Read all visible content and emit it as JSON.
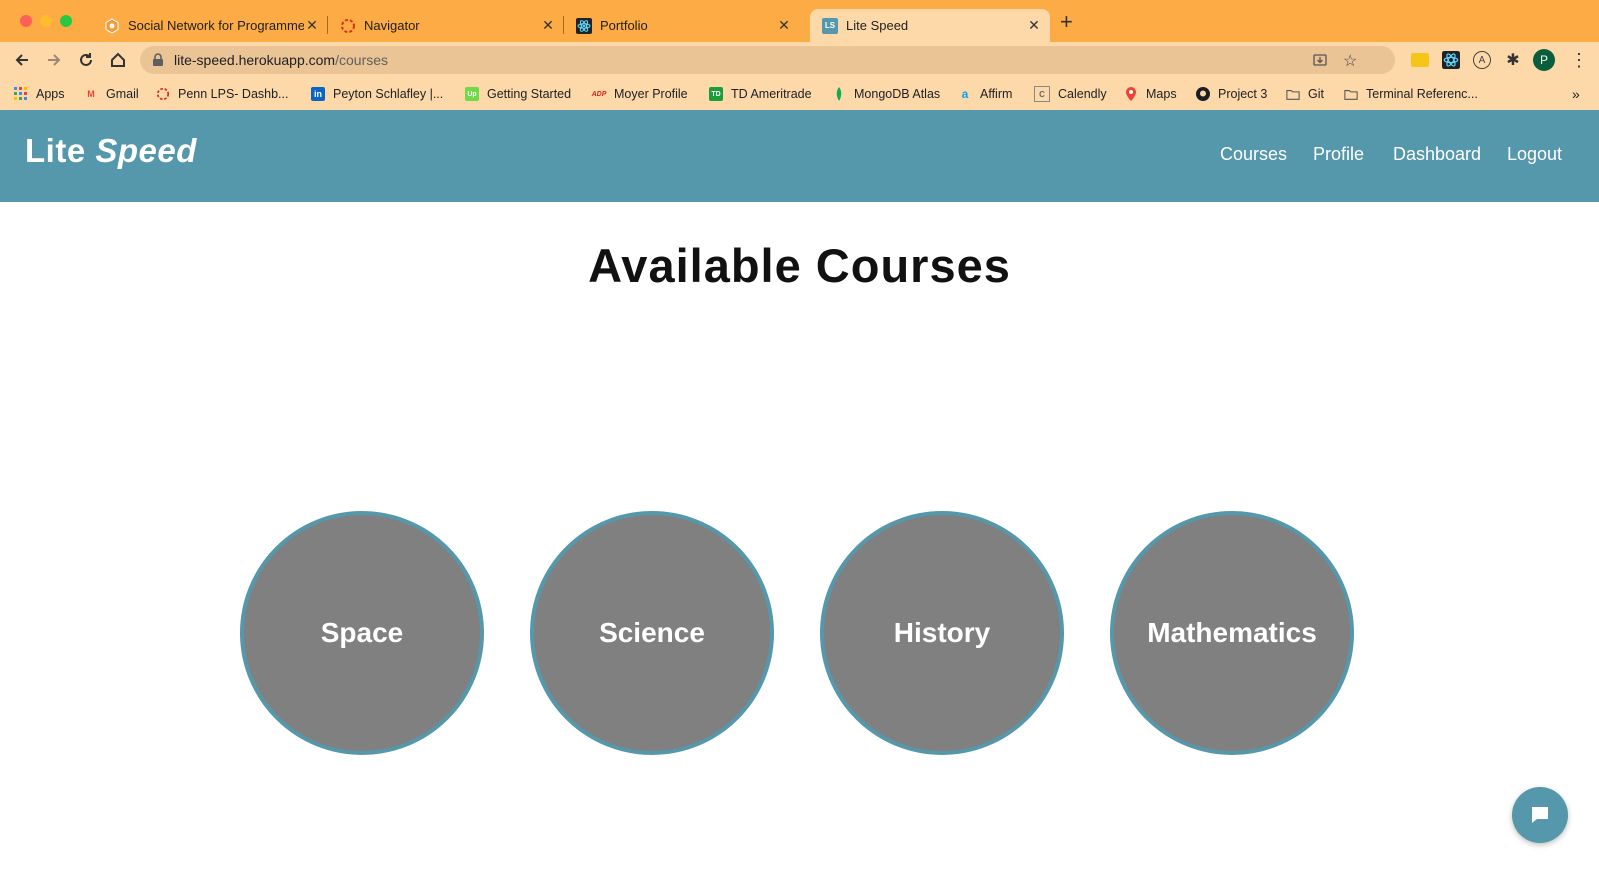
{
  "browser": {
    "tabs": [
      {
        "title": "Social Network for Programmers",
        "icon": "hexagon-icon"
      },
      {
        "title": "Navigator",
        "icon": "dashed-circle-icon"
      },
      {
        "title": "Portfolio",
        "icon": "react-icon"
      },
      {
        "title": "Lite Speed",
        "icon": "ls-icon",
        "favicon_text": "LS",
        "active": true
      }
    ],
    "url_host": "lite-speed.herokuapp.com",
    "url_path": "/courses",
    "profile_initial": "P",
    "bookmarks": [
      {
        "label": "Apps",
        "icon": "apps-grid-icon"
      },
      {
        "label": "Gmail",
        "icon": "gmail-icon",
        "icon_text": "M"
      },
      {
        "label": "Penn LPS- Dashb...",
        "icon": "dashed-circle-icon"
      },
      {
        "label": "Peyton Schlafley |...",
        "icon": "linkedin-icon",
        "icon_text": "in"
      },
      {
        "label": "Getting Started",
        "icon": "upwork-icon",
        "icon_text": "Up"
      },
      {
        "label": "Moyer Profile",
        "icon": "adp-icon",
        "icon_text": "ADP"
      },
      {
        "label": "TD Ameritrade",
        "icon": "td-icon",
        "icon_text": "TD"
      },
      {
        "label": "MongoDB Atlas",
        "icon": "mongodb-leaf-icon"
      },
      {
        "label": "Affirm",
        "icon": "affirm-icon",
        "icon_text": "a"
      },
      {
        "label": "Calendly",
        "icon": "calendly-icon",
        "icon_text": "C"
      },
      {
        "label": "Maps",
        "icon": "maps-pin-icon"
      },
      {
        "label": "Project 3",
        "icon": "github-icon"
      },
      {
        "label": "Git",
        "icon": "folder-icon"
      },
      {
        "label": "Terminal Referenc...",
        "icon": "folder-icon"
      }
    ]
  },
  "site": {
    "brand_main": "Lite",
    "brand_italic": "Speed",
    "nav": [
      "Courses",
      "Profile",
      "Dashboard",
      "Logout"
    ]
  },
  "page": {
    "title": "Available Courses",
    "courses": [
      "Space",
      "Science",
      "History",
      "Mathematics"
    ]
  },
  "colors": {
    "tab_strip": "#fdab44",
    "toolbar": "#fdd9a9",
    "navbar": "#5597ab",
    "course_fill": "#808080"
  }
}
